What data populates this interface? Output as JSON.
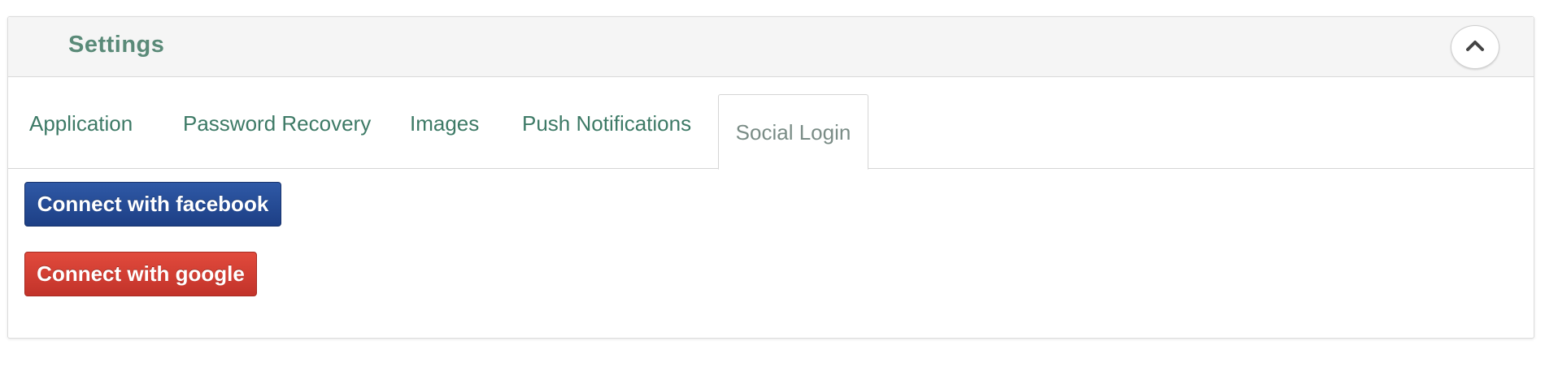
{
  "header": {
    "title": "Settings",
    "collapse_icon": "chevron-up-icon"
  },
  "tabs": [
    {
      "label": "Application",
      "active": false
    },
    {
      "label": "Password Recovery",
      "active": false
    },
    {
      "label": "Images",
      "active": false
    },
    {
      "label": "Push Notifications",
      "active": false
    },
    {
      "label": "Social Login",
      "active": true
    }
  ],
  "social": {
    "facebook_label": "Connect with facebook",
    "google_label": "Connect with google"
  },
  "colors": {
    "accent_text": "#3d7a66",
    "title_text": "#5a8a78",
    "facebook": "#254b96",
    "google": "#d13e32"
  }
}
